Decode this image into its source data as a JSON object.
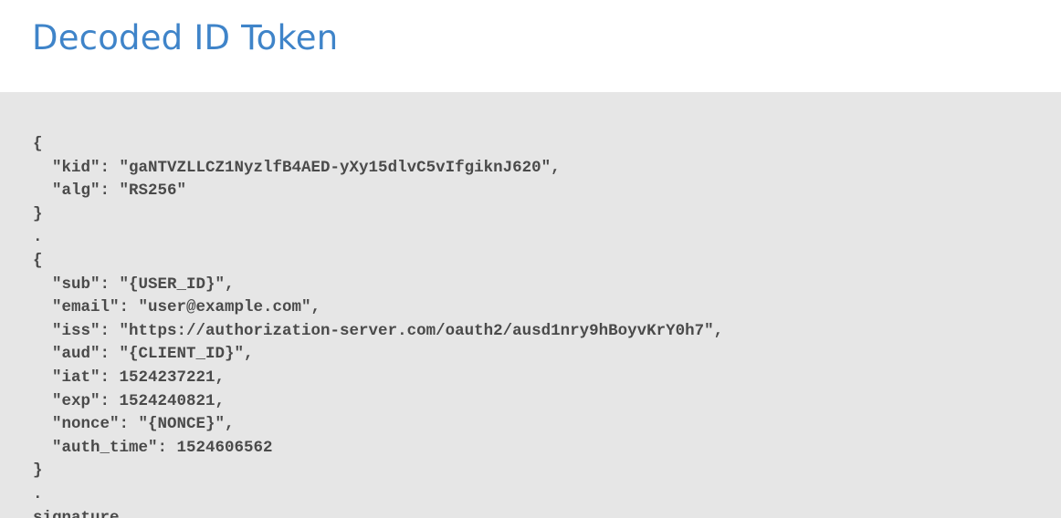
{
  "title": "Decoded ID Token",
  "code_lines": [
    "{",
    "  \"kid\": \"gaNTVZLLCZ1NyzlfB4AED-yXy15dlvC5vIfgiknJ620\",",
    "  \"alg\": \"RS256\"",
    "}",
    ".",
    "{",
    "  \"sub\": \"{USER_ID}\",",
    "  \"email\": \"user@example.com\",",
    "  \"iss\": \"https://authorization-server.com/oauth2/ausd1nry9hBoyvKrY0h7\",",
    "  \"aud\": \"{CLIENT_ID}\",",
    "  \"iat\": 1524237221,",
    "  \"exp\": 1524240821,",
    "  \"nonce\": \"{NONCE}\",",
    "  \"auth_time\": 1524606562",
    "}",
    ".",
    "signature"
  ]
}
